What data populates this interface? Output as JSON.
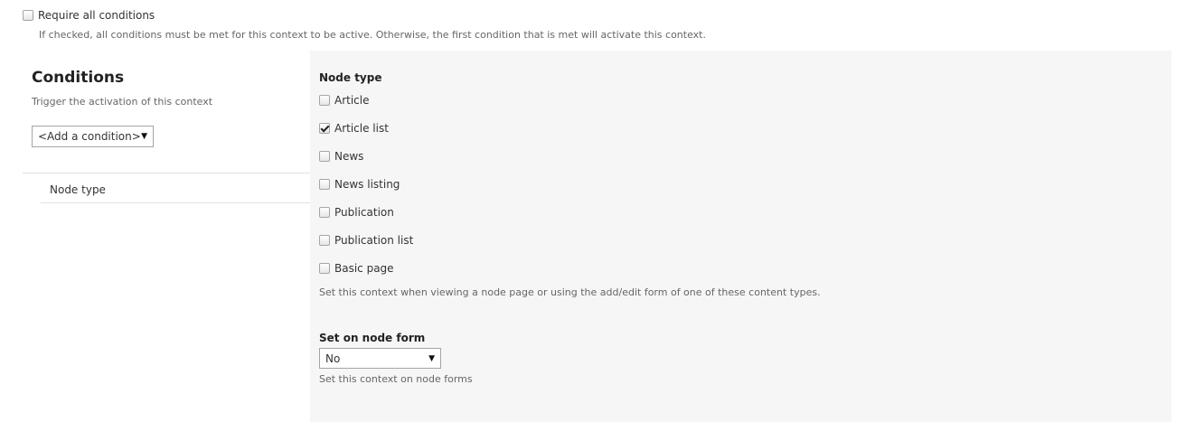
{
  "require_all": {
    "label": "Require all conditions",
    "checked": false,
    "description": "If checked, all conditions must be met for this context to be active. Otherwise, the first condition that is met will activate this context."
  },
  "conditions": {
    "title": "Conditions",
    "description": "Trigger the activation of this context",
    "add_select_value": "<Add a condition>",
    "tabs": [
      {
        "label": "Node type"
      }
    ]
  },
  "node_type": {
    "label": "Node type",
    "options": [
      {
        "label": "Article",
        "checked": false
      },
      {
        "label": "Article list",
        "checked": true
      },
      {
        "label": "News",
        "checked": false
      },
      {
        "label": "News listing",
        "checked": false
      },
      {
        "label": "Publication",
        "checked": false
      },
      {
        "label": "Publication list",
        "checked": false
      },
      {
        "label": "Basic page",
        "checked": false
      }
    ],
    "description": "Set this context when viewing a node page or using the add/edit form of one of these content types."
  },
  "node_form": {
    "label": "Set on node form",
    "select_value": "No",
    "description": "Set this context on node forms"
  }
}
